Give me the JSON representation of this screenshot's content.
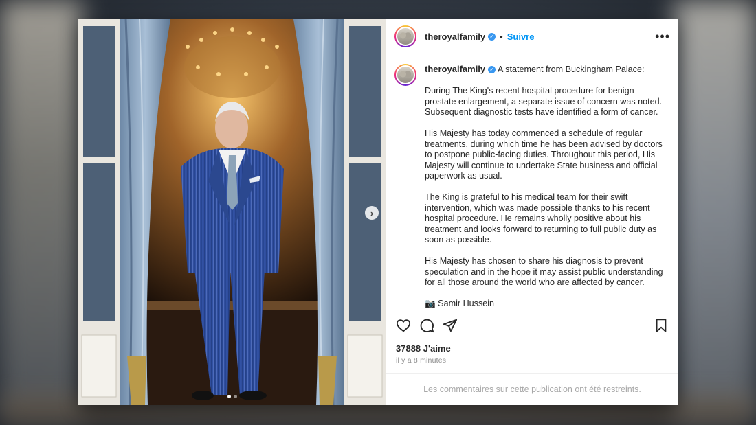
{
  "post": {
    "username": "theroyalfamily",
    "follow_label": "Suivre",
    "separator": "•",
    "more_label": "•••",
    "verified_mark": "✓",
    "caption_head": "A statement from Buckingham Palace:",
    "paragraphs": [
      "During The King's recent hospital procedure for benign prostate enlargement, a separate issue of concern was noted. Subsequent diagnostic tests have identified a form of cancer.",
      "His Majesty has today commenced a schedule of regular treatments, during which time he has been advised by doctors to postpone public-facing duties. Throughout this period, His Majesty will continue to undertake State business and official paperwork as usual.",
      "The King is grateful to his medical team for their swift intervention, which was made possible thanks to his recent hospital procedure. He remains wholly positive about his treatment and looks forward to returning to full public duty as soon as possible.",
      "His Majesty has chosen to share his diagnosis to prevent speculation and in the hope it may assist public understanding for all those around the world who are affected by cancer.",
      "📷 Samir Hussein"
    ],
    "likes": "37888 J'aime",
    "time": "il y a 8 minutes",
    "comments_restricted": "Les commentaires sur cette publication ont été restreints.",
    "carousel": {
      "next_glyph": "›",
      "slides": 2,
      "active_slide": 1
    }
  },
  "icons": {
    "like": "heart-icon",
    "comment": "comment-icon",
    "share": "paper-plane-icon",
    "save": "bookmark-icon",
    "more": "more-options-icon",
    "verified": "verified-badge-icon"
  },
  "colors": {
    "follow": "#0095f6",
    "verified": "#3897f0",
    "text": "#262626",
    "muted": "#8e8e8e",
    "suit": "#2f4f9e",
    "curtain": "#8fa8c4"
  }
}
